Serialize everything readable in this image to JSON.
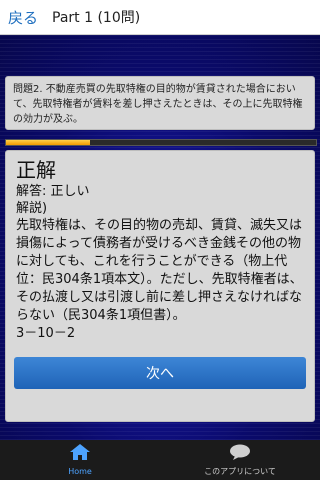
{
  "header": {
    "back_label": "戻る",
    "title": "Part 1 (10問)"
  },
  "question": {
    "text": "問題2. 不動産売買の先取特権の目的物が賃貸された場合において、先取特権者が賃料を差し押さえたときは、その上に先取特権の効力が及ぶ。"
  },
  "progress": {
    "fraction": 0.27
  },
  "answer": {
    "result": "正解",
    "answer_line": "解答: 正しい",
    "explanation_label": "解説)",
    "explanation": "先取特権は、その目的物の売却、賃貸、滅失又は損傷によって債務者が受けるべき金銭その他の物に対しても、これを行うことができる（物上代位：民304条1項本文）。ただし、先取特権者は、その払渡し又は引渡し前に差し押さえなければならない（民304条1項但書）。",
    "article_number": "3－10－2",
    "next_label": "次へ"
  },
  "tabs": {
    "home_label": "Home",
    "about_label": "このアプリについて",
    "active_color": "#4da3ff"
  }
}
